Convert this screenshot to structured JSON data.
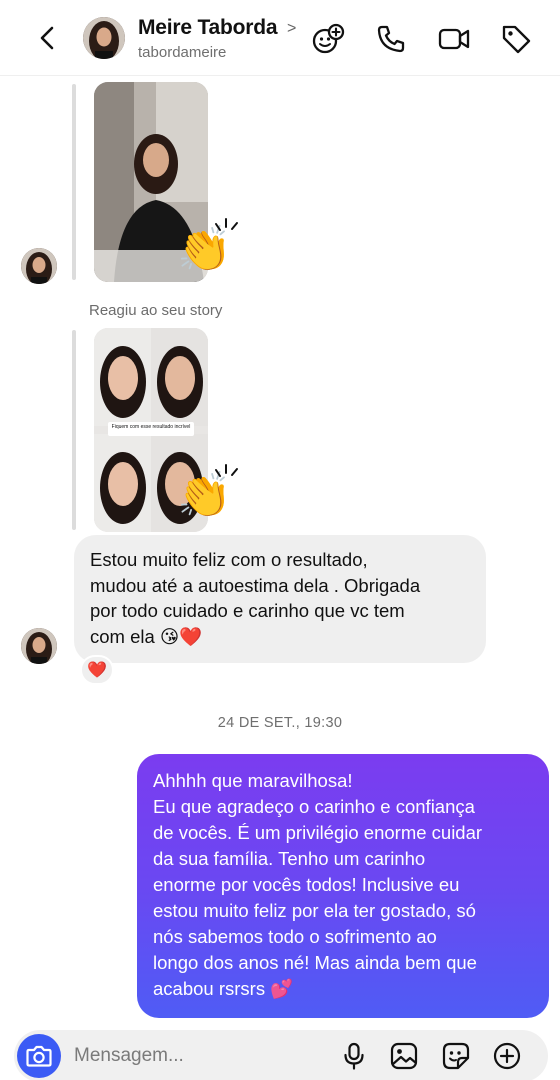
{
  "header": {
    "name": "Meire Taborda",
    "chevron": ">",
    "username": "tabordameire",
    "icons": [
      "back-icon",
      "add-friend-icon",
      "phone-icon",
      "video-icon",
      "tag-icon"
    ]
  },
  "thread": {
    "story_reaction_emoji": "👏",
    "reply_label": "Reagiu ao seu story",
    "story_overlay_text": "Fiquem com esse resultado incrível",
    "incoming_message": "Estou muito feliz com o resultado,\nmudou até a autoestima dela . Obrigada\npor todo cuidado e carinho que vc tem\ncom ela 😘❤️",
    "incoming_reaction": "❤️",
    "timestamp": "24 DE SET., 19:30",
    "outgoing_message": "Ahhhh que maravilhosa!\nEu que agradeço o carinho e confiança\nde vocês. É um privilégio enorme cuidar\nda sua família. Tenho um carinho\nenorme por vocês todos! Inclusive eu\nestou muito feliz por ela ter gostado, só\nnós sabemos todo o sofrimento ao\nlongo dos anos né! Mas ainda bem que\nacabou rsrsrs 💕"
  },
  "composer": {
    "placeholder": "Mensagem...",
    "icons": [
      "camera-icon",
      "microphone-icon",
      "gallery-icon",
      "sticker-icon",
      "plus-icon"
    ]
  },
  "colors": {
    "bubble_out_top": "#7b3cf0",
    "bubble_out_bottom": "#4f5cf5",
    "bubble_in": "#efefef",
    "camera_button": "#3b5bf5"
  }
}
